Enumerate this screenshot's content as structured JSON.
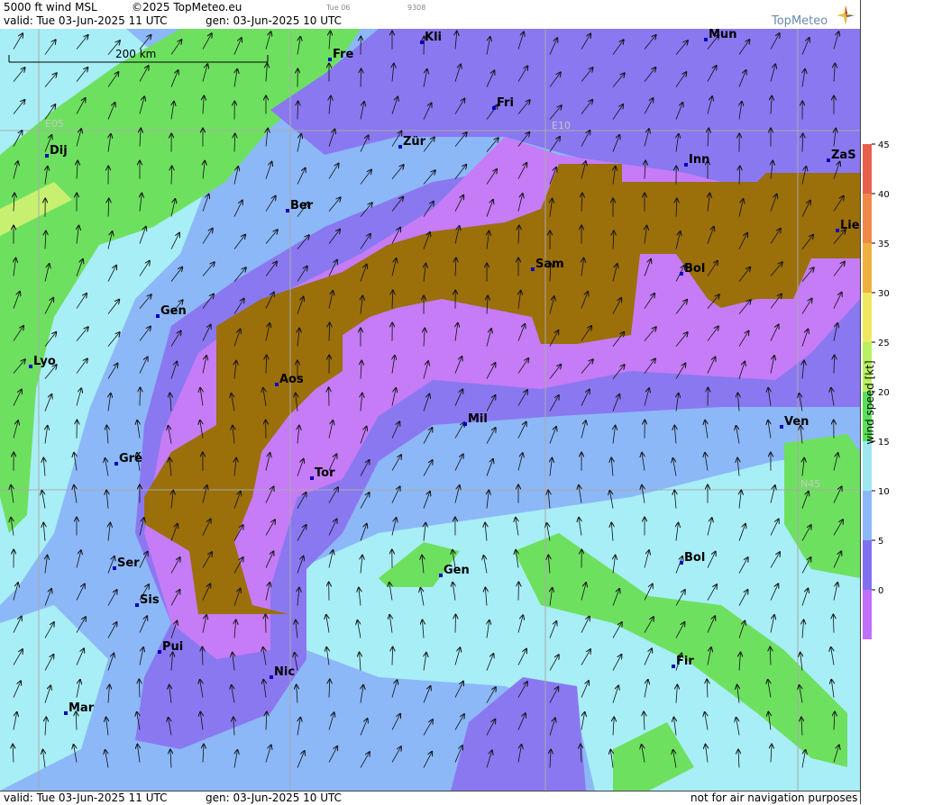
{
  "header": {
    "title": "5000 ft wind MSL",
    "copyright": "©2025 TopMeteo.eu",
    "day": "Tue 06",
    "code": "9308",
    "valid": "valid:  Tue  03-Jun-2025  11 UTC",
    "gen": "gen: 03-Jun-2025 10 UTC",
    "logo": "TopMeteo"
  },
  "map": {
    "scale_label": "200 km",
    "grid_labels": {
      "e05": "E05",
      "e10": "E10",
      "n45": "N45"
    },
    "cities": [
      {
        "name": "Kli"
      },
      {
        "name": "Mun"
      },
      {
        "name": "Fre"
      },
      {
        "name": "Fri"
      },
      {
        "name": "Dij"
      },
      {
        "name": "Zür"
      },
      {
        "name": "Inn"
      },
      {
        "name": "ZaS"
      },
      {
        "name": "Ber"
      },
      {
        "name": "Lie"
      },
      {
        "name": "Sam"
      },
      {
        "name": "Bol"
      },
      {
        "name": "Gen"
      },
      {
        "name": "Lyo"
      },
      {
        "name": "Aos"
      },
      {
        "name": "Mil"
      },
      {
        "name": "Ven"
      },
      {
        "name": "Gré"
      },
      {
        "name": "Tor"
      },
      {
        "name": "Ser"
      },
      {
        "name": "Gen"
      },
      {
        "name": "Bol"
      },
      {
        "name": "Sis"
      },
      {
        "name": "Pui"
      },
      {
        "name": "Nic"
      },
      {
        "name": "Fir"
      },
      {
        "name": "Mar"
      }
    ]
  },
  "footer": {
    "valid": "valid:  Tue  03-Jun-2025  11 UTC",
    "gen": "gen: 03-Jun-2025 10 UTC",
    "note": "not for air navigation purposes"
  },
  "legend": {
    "label": "wind speed [kt]",
    "ticks": [
      "45",
      "40",
      "35",
      "30",
      "25",
      "20",
      "15",
      "10",
      "5",
      "0"
    ],
    "colors": [
      "#e8604c",
      "#f08848",
      "#f0b040",
      "#f0e860",
      "#b8f060",
      "#58e058",
      "#a0e8f0",
      "#8cb8f8",
      "#8070f0",
      "#c070f8"
    ]
  }
}
